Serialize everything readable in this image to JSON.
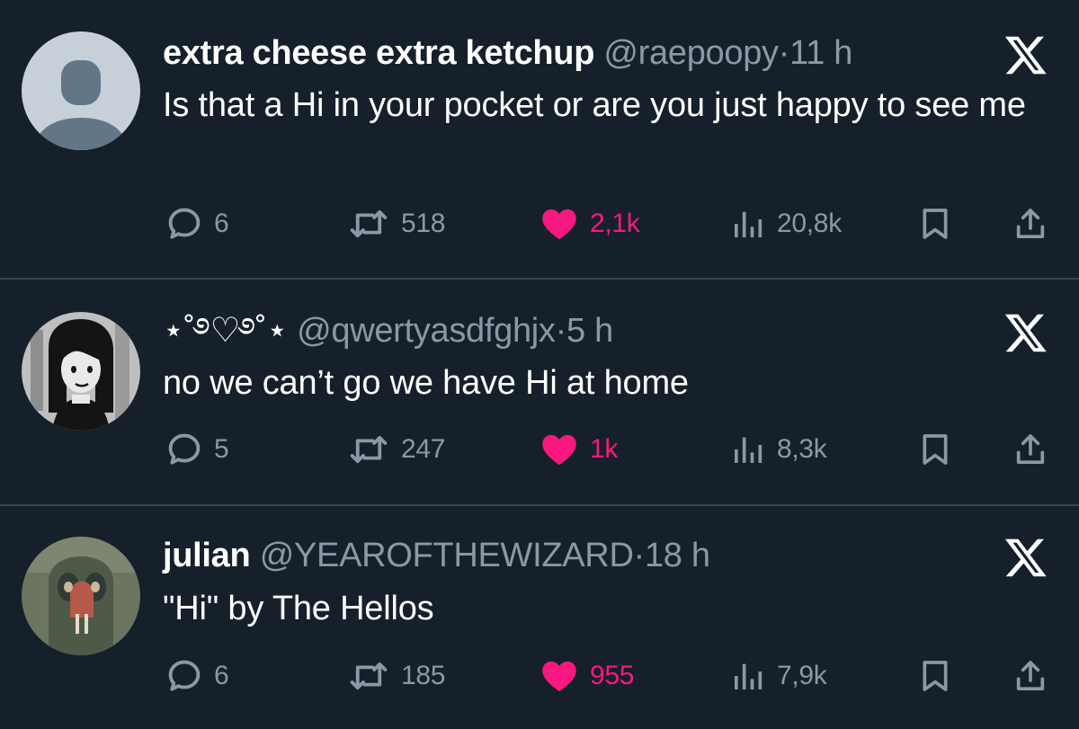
{
  "tweets": [
    {
      "name": "extra cheese extra ketchup",
      "handle": "@raepoopy",
      "separator": "·",
      "time": "11 h",
      "text": "Is that a Hi in your pocket or are you just happy to see me",
      "replies": "6",
      "retweets": "518",
      "likes": "2,1k",
      "views": "20,8k",
      "avatar_icon": "default-avatar-icon"
    },
    {
      "name": "⋆˚࿔♡࿔˚⋆",
      "handle": "@qwertyasdfghjx",
      "separator": "·",
      "time": "5 h",
      "text": "no we can’t go we have Hi at home",
      "replies": "5",
      "retweets": "247",
      "likes": "1k",
      "views": "8,3k",
      "avatar_icon": "cartoon-girl-avatar-icon"
    },
    {
      "name": "julian",
      "handle": "@YEAROFTHEWIZARD",
      "separator": "·",
      "time": "18 h",
      "text": "\"Hi\" by The Hellos",
      "replies": "6",
      "retweets": "185",
      "likes": "955",
      "views": "7,9k",
      "avatar_icon": "mask-painting-avatar-icon"
    }
  ],
  "colors": {
    "background": "#15202b",
    "separator": "#38444d",
    "muted": "#8b98a5",
    "like": "#f91880",
    "text": "#ffffff"
  },
  "icons": [
    "reply-icon",
    "retweet-icon",
    "like-icon",
    "views-icon",
    "bookmark-icon",
    "share-icon",
    "x-logo-icon"
  ]
}
